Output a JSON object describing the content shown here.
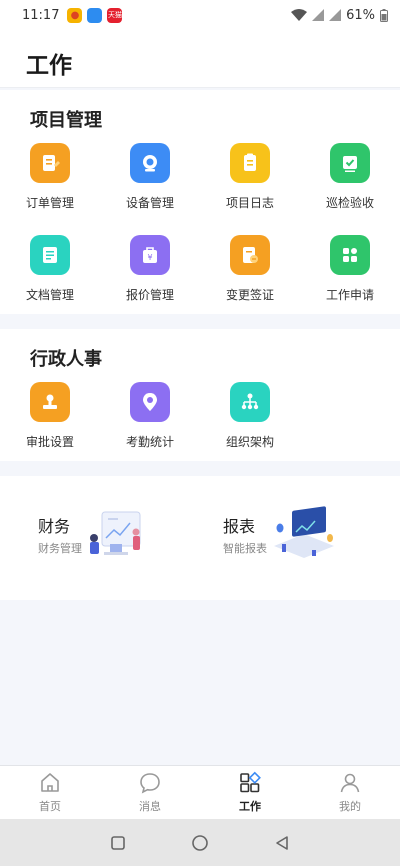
{
  "status": {
    "time": "11:17",
    "battery": "61%",
    "app3_label": "天猫"
  },
  "header": {
    "title": "工作"
  },
  "project": {
    "title": "项目管理",
    "items": [
      {
        "label": "订单管理",
        "icon": "order-icon",
        "color": "#f5a022"
      },
      {
        "label": "设备管理",
        "icon": "camera-icon",
        "color": "#3d8cf5"
      },
      {
        "label": "项目日志",
        "icon": "log-icon",
        "color": "#f7c21a"
      },
      {
        "label": "巡检验收",
        "icon": "inspection-icon",
        "color": "#2fc56b"
      },
      {
        "label": "文档管理",
        "icon": "document-icon",
        "color": "#2ad3c0"
      },
      {
        "label": "报价管理",
        "icon": "quote-icon",
        "color": "#8c6ff2"
      },
      {
        "label": "变更签证",
        "icon": "change-icon",
        "color": "#f5a022"
      },
      {
        "label": "工作申请",
        "icon": "apply-icon",
        "color": "#2fc56b"
      }
    ]
  },
  "admin": {
    "title": "行政人事",
    "items": [
      {
        "label": "审批设置",
        "icon": "stamp-icon",
        "color": "#f5a022"
      },
      {
        "label": "考勤统计",
        "icon": "location-icon",
        "color": "#8c6ff2"
      },
      {
        "label": "组织架构",
        "icon": "org-icon",
        "color": "#2ad3c0"
      }
    ]
  },
  "cards": {
    "finance": {
      "title": "财务",
      "subtitle": "财务管理"
    },
    "report": {
      "title": "报表",
      "subtitle": "智能报表"
    }
  },
  "tabs": [
    {
      "label": "首页",
      "icon": "home-icon",
      "active": false
    },
    {
      "label": "消息",
      "icon": "message-icon",
      "active": false
    },
    {
      "label": "工作",
      "icon": "grid-icon",
      "active": true
    },
    {
      "label": "我的",
      "icon": "profile-icon",
      "active": false
    }
  ]
}
